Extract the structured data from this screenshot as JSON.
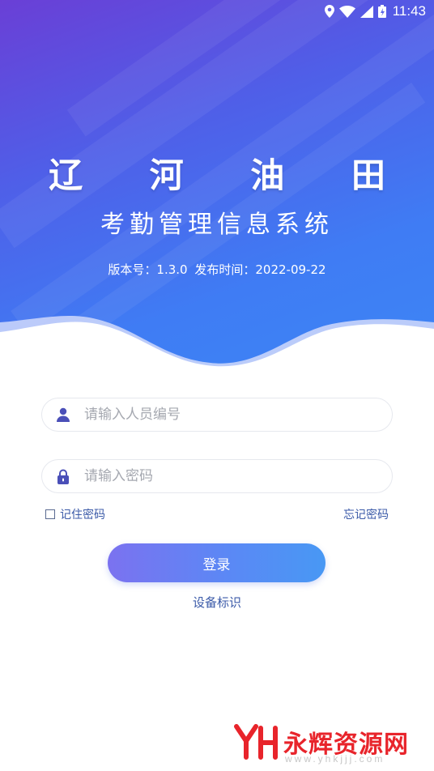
{
  "status_bar": {
    "time": "11:43"
  },
  "header": {
    "title": "辽 河 油 田",
    "subtitle": "考勤管理信息系统",
    "version_label": "版本号：1.3.0",
    "release_label": "发布时间：2022-09-22"
  },
  "form": {
    "user_placeholder": "请输入人员编号",
    "password_placeholder": "请输入密码",
    "remember_label": "记住密码",
    "forgot_label": "忘记密码",
    "login_label": "登录",
    "device_label": "设备标识"
  },
  "watermark": {
    "brand": "永辉资源网",
    "url": "www.yhkjjj.com"
  },
  "colors": {
    "gradient_start": "#6a3fd6",
    "gradient_end": "#3d86f5",
    "link": "#3b5aa8",
    "button_start": "#7b72f0",
    "button_end": "#4898f4",
    "watermark": "#e8242b"
  },
  "icons": [
    "location-icon",
    "wifi-icon",
    "signal-icon",
    "battery-icon",
    "user-icon",
    "lock-icon"
  ]
}
